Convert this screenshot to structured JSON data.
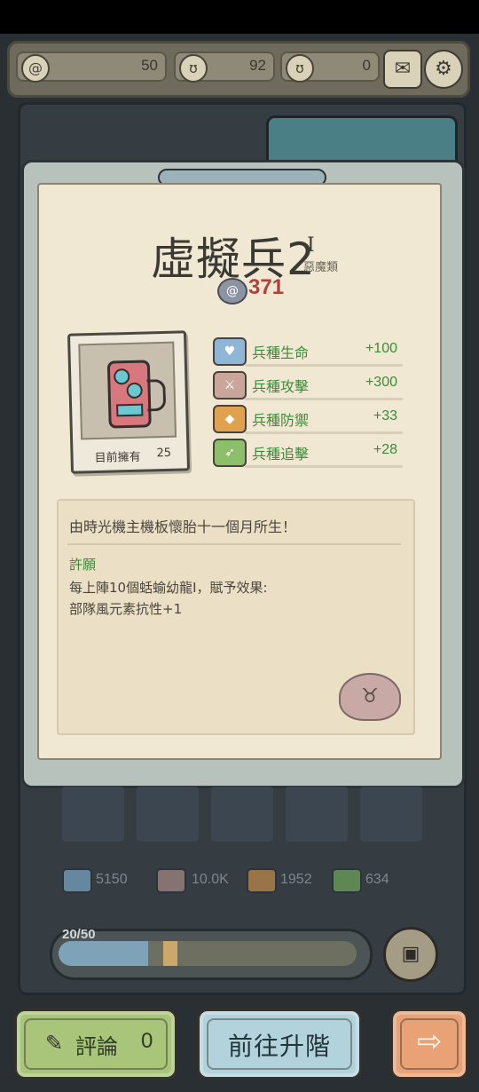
{
  "resources": [
    {
      "icon": "snail-icon",
      "glyph": "@",
      "value": "50"
    },
    {
      "icon": "slug-icon",
      "glyph": "ʊ",
      "value": "92"
    },
    {
      "icon": "slug-icon-2",
      "glyph": "ʊ",
      "value": "0"
    }
  ],
  "top_buttons": {
    "mail_icon": "✉",
    "settings_icon": "⚙"
  },
  "unit": {
    "name": "虛擬兵2",
    "rank": "I",
    "category": "惡魔類",
    "cost": "371",
    "cost_icon": "@",
    "owned_label": "目前擁有",
    "owned_count": "25"
  },
  "stats": [
    {
      "name": "兵種生命",
      "value": "+100",
      "icon": "life-stat-icon",
      "color": "#8fb6d6"
    },
    {
      "name": "兵種攻擊",
      "value": "+300",
      "icon": "attack-stat-icon",
      "color": "#c9a59a"
    },
    {
      "name": "兵種防禦",
      "value": "+33",
      "icon": "defense-stat-icon",
      "color": "#e0a24d"
    },
    {
      "name": "兵種追擊",
      "value": "+28",
      "icon": "pursuit-stat-icon",
      "color": "#8bbf6a"
    }
  ],
  "description": {
    "flavor": "由時光機主機板懷胎十一個月所生！",
    "wish_title": "許願",
    "wish_line1": "每上陣10個蛞蝓幼龍Ⅰ，賦予效果:",
    "wish_line2": "部隊風元素抗性+1"
  },
  "summary": [
    {
      "value": "5150",
      "color": "#7da7c7"
    },
    {
      "value": "10.0K",
      "color": "#a88a85"
    },
    {
      "value": "1952",
      "color": "#c28d4a"
    },
    {
      "value": "634",
      "color": "#73a85b"
    }
  ],
  "progress": {
    "label": "20/50",
    "fraction": 0.4
  },
  "buttons": {
    "review_label": "評論",
    "review_count": "0",
    "upgrade_label": "前往升階",
    "next_icon": "⇨"
  },
  "colors": {
    "stat_text": "#3e8a3b",
    "cost": "#b0423c"
  }
}
